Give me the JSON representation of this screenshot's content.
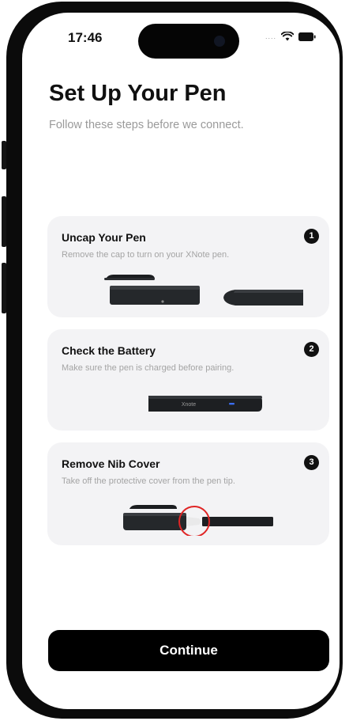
{
  "status_bar": {
    "time": "17:46",
    "signal_dots": "....",
    "wifi_icon": "wifi-icon",
    "battery_icon": "battery-icon"
  },
  "header": {
    "title": "Set Up Your Pen",
    "subtitle": "Follow these steps before we connect."
  },
  "steps": [
    {
      "number": "1",
      "title": "Uncap Your Pen",
      "description": "Remove the cap to turn on your XNote pen."
    },
    {
      "number": "2",
      "title": "Check the Battery",
      "description": "Make sure the pen is charged before pairing.",
      "pen_label": "Xnote"
    },
    {
      "number": "3",
      "title": "Remove Nib Cover",
      "description": "Take off the protective cover from the pen tip."
    }
  ],
  "continue_button": {
    "label": "Continue"
  },
  "colors": {
    "accent": "#000000",
    "card_bg": "#f3f3f5",
    "highlight_circle": "#e02525",
    "led": "#3b6df0"
  }
}
